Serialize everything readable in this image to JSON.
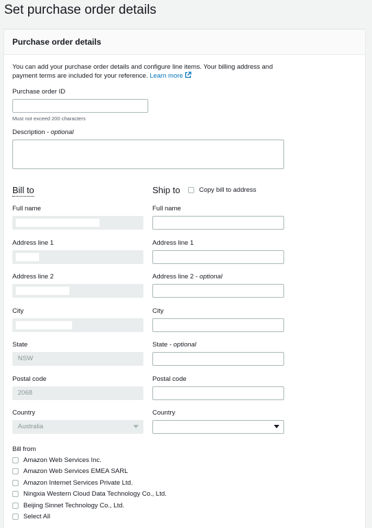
{
  "page": {
    "title": "Set purchase order details"
  },
  "panel": {
    "title": "Purchase order details",
    "intro": "You can add your purchase order details and configure line items. Your billing address and payment terms are included for your reference.",
    "learn_more": "Learn more"
  },
  "po_id": {
    "label": "Purchase order ID",
    "value": "",
    "hint": "Must not exceed 200 characters"
  },
  "description": {
    "label": "Description",
    "optional": "optional",
    "value": ""
  },
  "bill_to": {
    "heading": "Bill to",
    "full_name_label": "Full name",
    "address1_label": "Address line 1",
    "address2_label": "Address line 2",
    "city_label": "City",
    "state_label": "State",
    "state_value": "NSW",
    "postal_label": "Postal code",
    "postal_value": "2068",
    "country_label": "Country",
    "country_value": "Australia"
  },
  "ship_to": {
    "heading": "Ship to",
    "copy_label": "Copy bill to address",
    "full_name_label": "Full name",
    "address1_label": "Address line 1",
    "address2_label": "Address line 2",
    "address2_optional": "optional",
    "city_label": "City",
    "state_label": "State",
    "state_optional": "optional",
    "postal_label": "Postal code",
    "country_label": "Country",
    "country_value": ""
  },
  "bill_from": {
    "label": "Bill from",
    "options": [
      "Amazon Web Services Inc.",
      "Amazon Web Services EMEA SARL",
      "Amazon Internet Services Private Ltd.",
      "Ningxia Western Cloud Data Technology Co., Ltd.",
      "Beijing Sinnet Technology Co., Ltd.",
      "Select All"
    ]
  },
  "colors": {
    "link": "#0073bb",
    "disabled_bg": "#eaeded",
    "border": "#aab7b8"
  }
}
